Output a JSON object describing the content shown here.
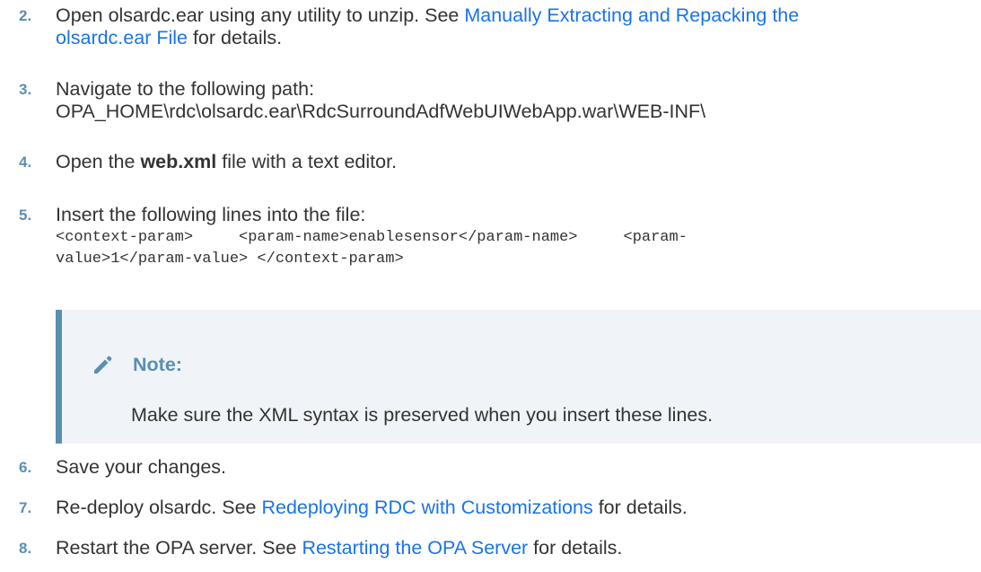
{
  "steps": [
    {
      "num": "2.",
      "text_before": "Open olsardc.ear using any utility to unzip. See ",
      "link_line1": "Manually Extracting and Repacking the",
      "link_line2": "olsardc.ear File",
      "text_after": " for details."
    },
    {
      "num": "3.",
      "line1": "Navigate to the following path:",
      "line2": "OPA_HOME\\rdc\\olsardc.ear\\RdcSurroundAdfWebUIWebApp.war\\WEB-INF\\"
    },
    {
      "num": "4.",
      "text_before": "Open the ",
      "bold": "web.xml",
      "text_after": " file with a text editor."
    },
    {
      "num": "5.",
      "text": "Insert the following lines into the file:",
      "code_line1": "<context-param>     <param-name>enablesensor</param-name>     <param-",
      "code_line2": "value>1</param-value> </context-param>"
    },
    {
      "num": "6.",
      "text": "Save your changes."
    },
    {
      "num": "7.",
      "text_before": "Re-deploy olsardc. See ",
      "link": "Redeploying RDC with Customizations",
      "text_after": " for details."
    },
    {
      "num": "8.",
      "text_before": "Restart the OPA server. See ",
      "link": "Restarting the OPA Server",
      "text_after": " for details."
    }
  ],
  "note": {
    "icon": "pencil-icon",
    "title": "Note:",
    "body": "Make sure the XML syntax is preserved when you insert these lines."
  },
  "colors": {
    "link": "#1a73e8",
    "step_number": "#5a8fb0",
    "note_bg": "#f0f4f8",
    "note_border": "#5a8fb0",
    "text": "#333333"
  }
}
